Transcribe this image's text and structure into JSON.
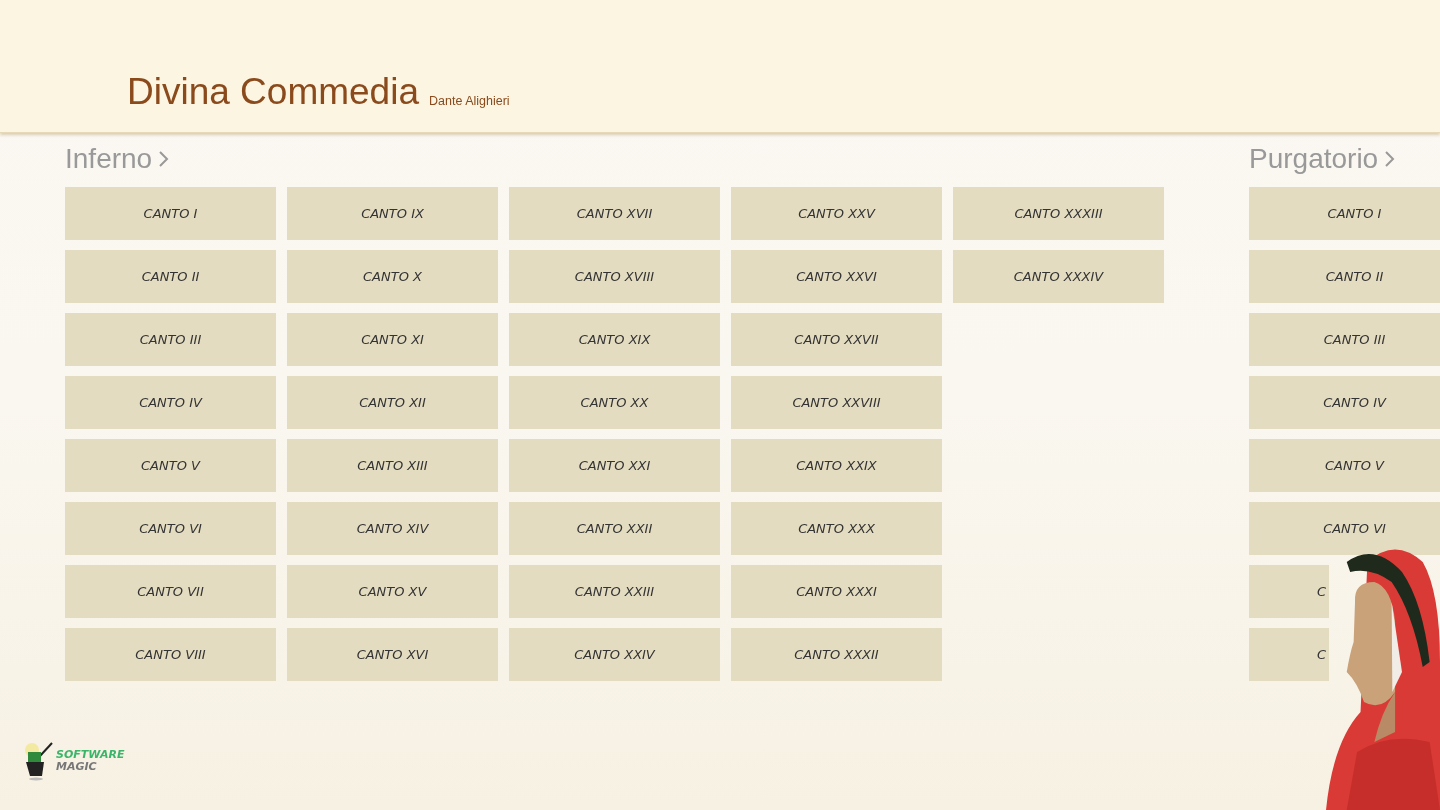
{
  "app": {
    "title": "Divina Commedia",
    "author": "Dante Alighieri"
  },
  "sections": [
    {
      "title": "Inferno",
      "cantos": [
        {
          "label": "CANTO I",
          "kind": "full"
        },
        {
          "label": "CANTO II",
          "kind": "full"
        },
        {
          "label": "CANTO III",
          "kind": "full"
        },
        {
          "label": "CANTO IV",
          "kind": "full"
        },
        {
          "label": "CANTO V",
          "kind": "full"
        },
        {
          "label": "CANTO VI",
          "kind": "full"
        },
        {
          "label": "CANTO VII",
          "kind": "full"
        },
        {
          "label": "CANTO VIII",
          "kind": "full"
        },
        {
          "label": "CANTO IX",
          "kind": "full"
        },
        {
          "label": "CANTO X",
          "kind": "full"
        },
        {
          "label": "CANTO XI",
          "kind": "full"
        },
        {
          "label": "CANTO XII",
          "kind": "full"
        },
        {
          "label": "CANTO XIII",
          "kind": "full"
        },
        {
          "label": "CANTO XIV",
          "kind": "full"
        },
        {
          "label": "CANTO XV",
          "kind": "full"
        },
        {
          "label": "CANTO XVI",
          "kind": "full"
        },
        {
          "label": "CANTO XVII",
          "kind": "full"
        },
        {
          "label": "CANTO XVIII",
          "kind": "full"
        },
        {
          "label": "CANTO XIX",
          "kind": "full"
        },
        {
          "label": "CANTO XX",
          "kind": "full"
        },
        {
          "label": "CANTO XXI",
          "kind": "full"
        },
        {
          "label": "CANTO XXII",
          "kind": "full"
        },
        {
          "label": "CANTO XXIII",
          "kind": "full"
        },
        {
          "label": "CANTO XXIV",
          "kind": "full"
        },
        {
          "label": "CANTO XXV",
          "kind": "full"
        },
        {
          "label": "CANTO XXVI",
          "kind": "full"
        },
        {
          "label": "CANTO XXVII",
          "kind": "full"
        },
        {
          "label": "CANTO XXVIII",
          "kind": "full"
        },
        {
          "label": "CANTO XXIX",
          "kind": "full"
        },
        {
          "label": "CANTO XXX",
          "kind": "full"
        },
        {
          "label": "CANTO XXXI",
          "kind": "full"
        },
        {
          "label": "CANTO XXXII",
          "kind": "full"
        },
        {
          "label": "CANTO XXXIII",
          "kind": "full"
        },
        {
          "label": "CANTO XXXIV",
          "kind": "full"
        }
      ]
    },
    {
      "title": "Purgatorio",
      "cantos": [
        {
          "label": "CANTO I",
          "kind": "full"
        },
        {
          "label": "CANTO II",
          "kind": "full"
        },
        {
          "label": "CANTO III",
          "kind": "full"
        },
        {
          "label": "CANTO IV",
          "kind": "full"
        },
        {
          "label": "CANTO V",
          "kind": "full"
        },
        {
          "label": "CANTO VI",
          "kind": "full"
        },
        {
          "label": "C",
          "kind": "cut"
        },
        {
          "label": "C",
          "kind": "cut"
        }
      ]
    }
  ],
  "logo": {
    "line_1": "SOFTWARE",
    "line_2": "MAGIC"
  }
}
